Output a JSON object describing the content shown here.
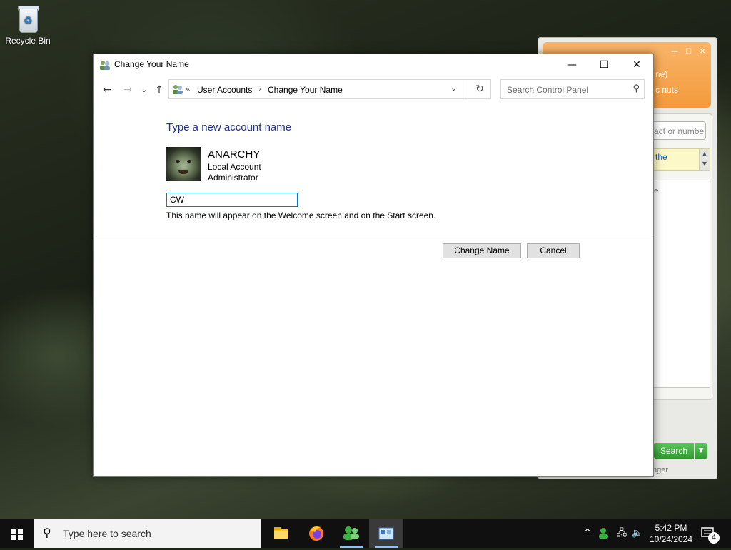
{
  "desktop": {
    "recycle_bin_label": "Recycle Bin"
  },
  "background_window": {
    "header_line1": "ne)",
    "header_line2": "c nuts",
    "search_placeholder": "act or numbe",
    "list_link": "the",
    "inner_text": "e",
    "search_button": "Search",
    "footer_text": "nger"
  },
  "window": {
    "title": "Change Your Name",
    "controls": {
      "minimize": "—",
      "maximize": "☐",
      "close": "✕"
    },
    "nav": {
      "back": "←",
      "forward": "→",
      "recent": "⌄",
      "up": "↑"
    },
    "breadcrumb": {
      "prefix": "«",
      "items": [
        "User Accounts",
        "Change Your Name"
      ],
      "separator": "›"
    },
    "search_placeholder": "Search Control Panel",
    "heading": "Type a new account name",
    "account": {
      "name": "ANARCHY",
      "type": "Local Account",
      "role": "Administrator"
    },
    "name_input_value": "CW",
    "hint": "This name will appear on the Welcome screen and on the Start screen.",
    "buttons": {
      "change_name": "Change Name",
      "cancel": "Cancel"
    }
  },
  "taskbar": {
    "search_placeholder": "Type here to search",
    "apps": [
      "file-explorer",
      "firefox",
      "messenger",
      "control-panel"
    ],
    "time": "5:42 PM",
    "date": "10/24/2024",
    "notification_count": "4"
  },
  "colors": {
    "heading": "#1e3287",
    "input_border": "#0078d7",
    "taskbar": "#101010",
    "orange_header": "#f39a3c",
    "green_button": "#2f9a2f"
  }
}
